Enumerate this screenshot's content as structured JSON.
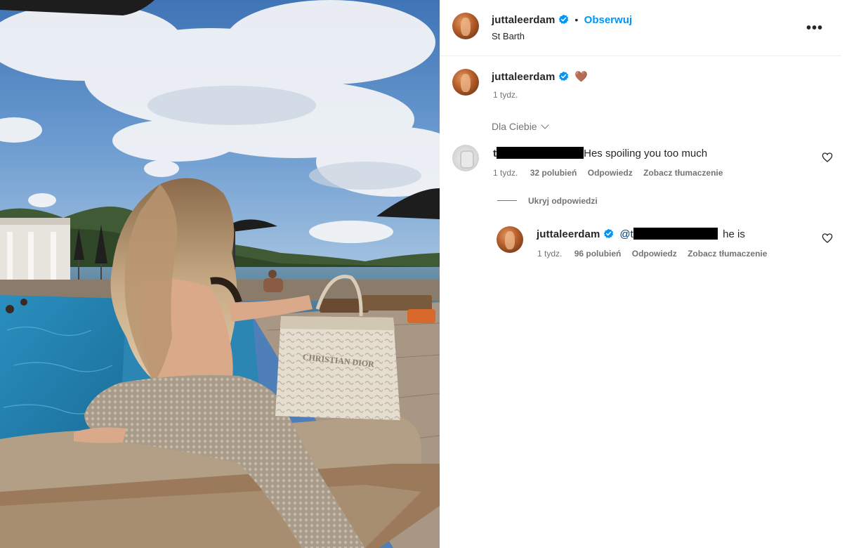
{
  "post": {
    "username": "juttaleerdam",
    "follow_label": "Obserwuj",
    "location": "St Barth",
    "more_label": "•••",
    "photo_bag_text": "CHRISTIAN DIOR"
  },
  "caption": {
    "username": "juttaleerdam",
    "emoji": "🤎",
    "time": "1 tydz."
  },
  "sort": {
    "label": "Dla Ciebie"
  },
  "comments": [
    {
      "username_visible": "t",
      "text": "Hes spoiling you too much",
      "time": "1 tydz.",
      "likes": "32 polubień",
      "reply_label": "Odpowiedz",
      "translate_label": "Zobacz tłumaczenie"
    }
  ],
  "replies_toggle": {
    "label": "Ukryj odpowiedzi"
  },
  "reply": {
    "username": "juttaleerdam",
    "mention_visible": "@t",
    "text": "he is",
    "time": "1 tydz.",
    "likes": "96 polubień",
    "reply_label": "Odpowiedz",
    "translate_label": "Zobacz tłumaczenie"
  },
  "colors": {
    "link_blue": "#0095f6",
    "verified_blue": "#0095f6",
    "muted_text": "#737373"
  }
}
